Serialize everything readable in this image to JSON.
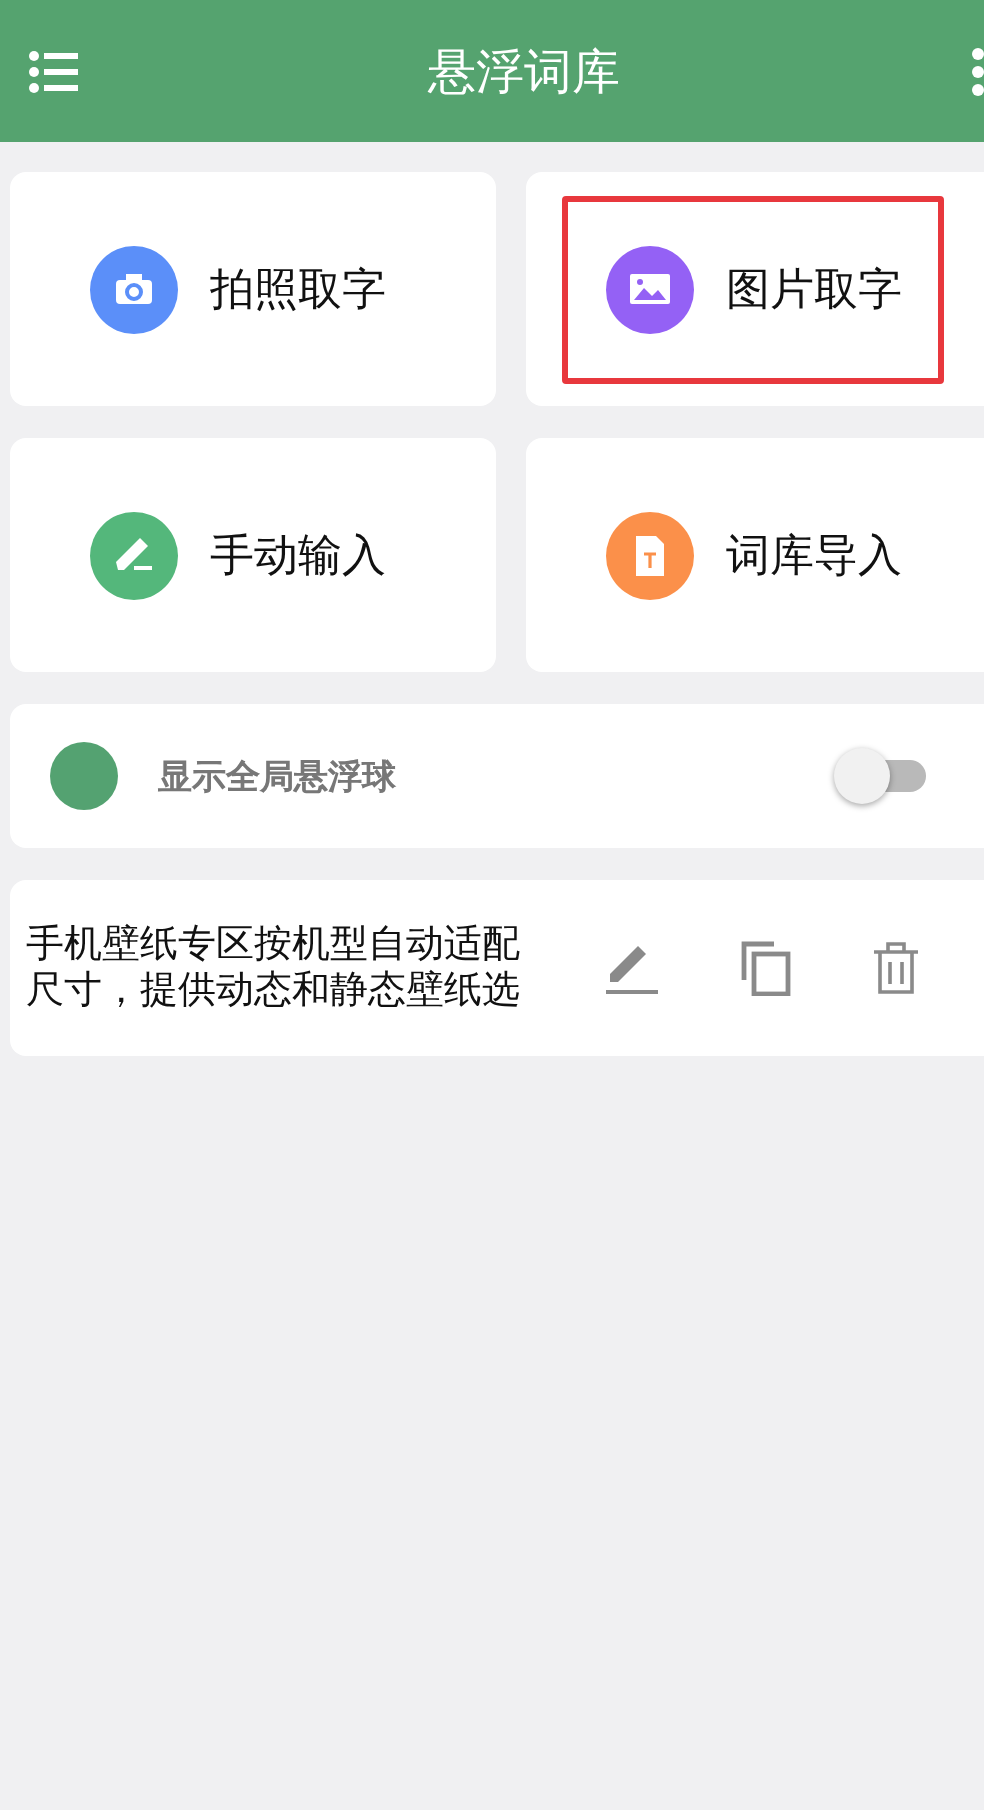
{
  "app_bar": {
    "title": "悬浮词库"
  },
  "actions": [
    {
      "kind": "camera",
      "label": "拍照取字",
      "color": "#5b8ff9",
      "highlighted": false
    },
    {
      "kind": "image",
      "label": "图片取字",
      "color": "#9461f5",
      "highlighted": true
    },
    {
      "kind": "pen",
      "label": "手动输入",
      "color": "#54b77b",
      "highlighted": false
    },
    {
      "kind": "file",
      "label": "词库导入",
      "color": "#fb904a",
      "highlighted": false
    }
  ],
  "float_ball": {
    "label": "显示全局悬浮球",
    "color": "#54a271",
    "on": false
  },
  "entries": [
    {
      "text": "手机壁纸专区按机型自动适配尺寸，提供动态和静态壁纸选"
    }
  ]
}
